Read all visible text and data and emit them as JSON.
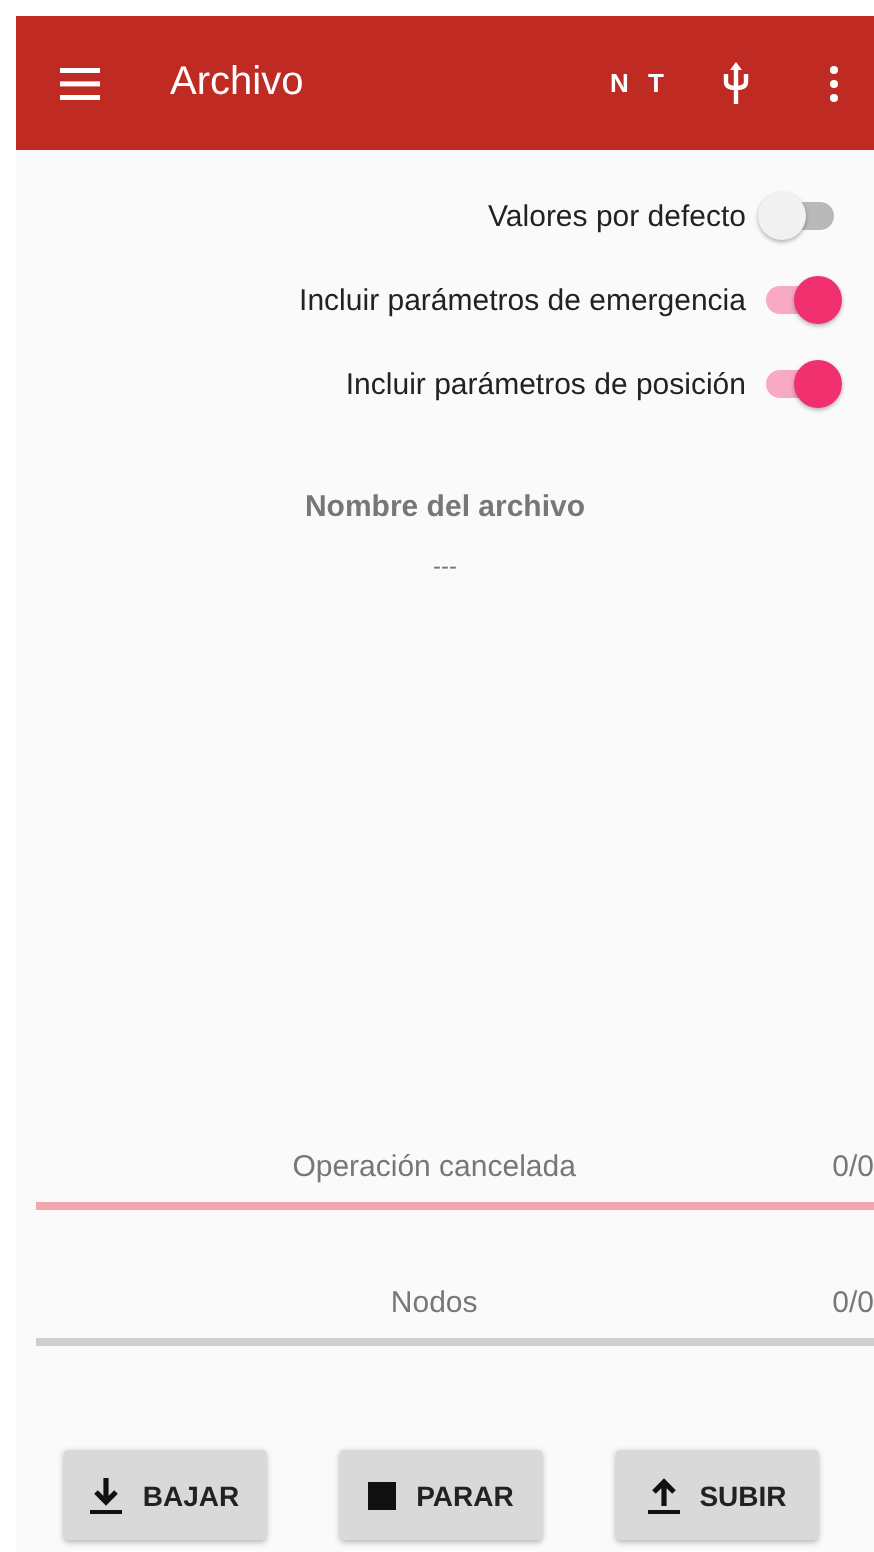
{
  "app_bar": {
    "title": "Archivo",
    "status": "N T"
  },
  "toggles": [
    {
      "label": "Valores por defecto",
      "on": false
    },
    {
      "label": "Incluir parámetros de emergencia",
      "on": true
    },
    {
      "label": "Incluir parámetros de posición",
      "on": true
    }
  ],
  "file": {
    "heading": "Nombre del archivo",
    "value": "---"
  },
  "progress": [
    {
      "label": "Operación cancelada",
      "count": "0/0",
      "color": "#f4a6ae"
    },
    {
      "label": "Nodos",
      "count": "0/0",
      "color": "#cfcfcf"
    }
  ],
  "buttons": [
    {
      "label": "BAJAR",
      "kind": "download"
    },
    {
      "label": "PARAR",
      "kind": "stop"
    },
    {
      "label": "SUBIR",
      "kind": "upload"
    }
  ]
}
